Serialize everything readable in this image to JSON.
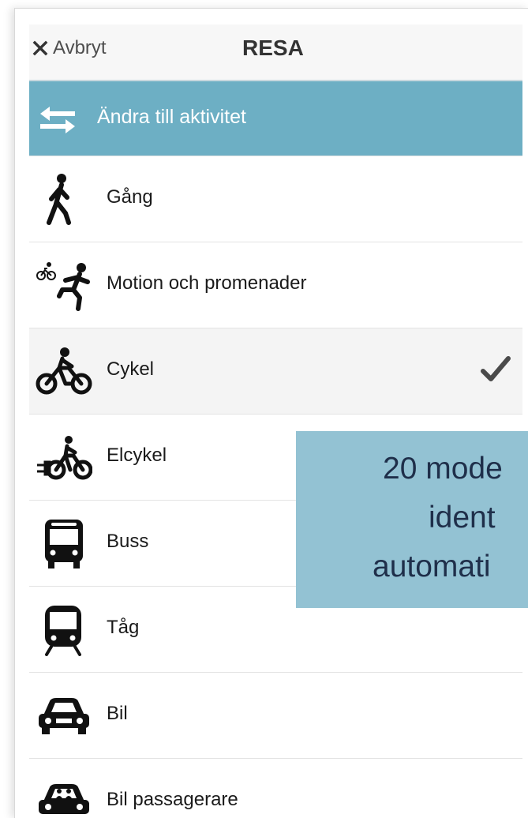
{
  "header": {
    "cancel_label": "Avbryt",
    "title": "RESA"
  },
  "change": {
    "label": "Ändra till aktivitet"
  },
  "modes": [
    {
      "label": "Gång",
      "icon": "walking-icon"
    },
    {
      "label": "Motion och promenader",
      "icon": "exercise-icon"
    },
    {
      "label": "Cykel",
      "icon": "bicycle-icon",
      "selected": true
    },
    {
      "label": "Elcykel",
      "icon": "ebike-icon"
    },
    {
      "label": "Buss",
      "icon": "bus-icon"
    },
    {
      "label": "Tåg",
      "icon": "train-icon"
    },
    {
      "label": "Bil",
      "icon": "car-icon"
    },
    {
      "label": "Bil passagerare",
      "icon": "car-passenger-icon"
    }
  ],
  "overlay": {
    "line1": "20 mode",
    "line2": "ident",
    "line3": "automati"
  },
  "colors": {
    "accent": "#6dafc4",
    "overlay_bg": "#93c2d3",
    "overlay_text": "#1f2f4a"
  }
}
